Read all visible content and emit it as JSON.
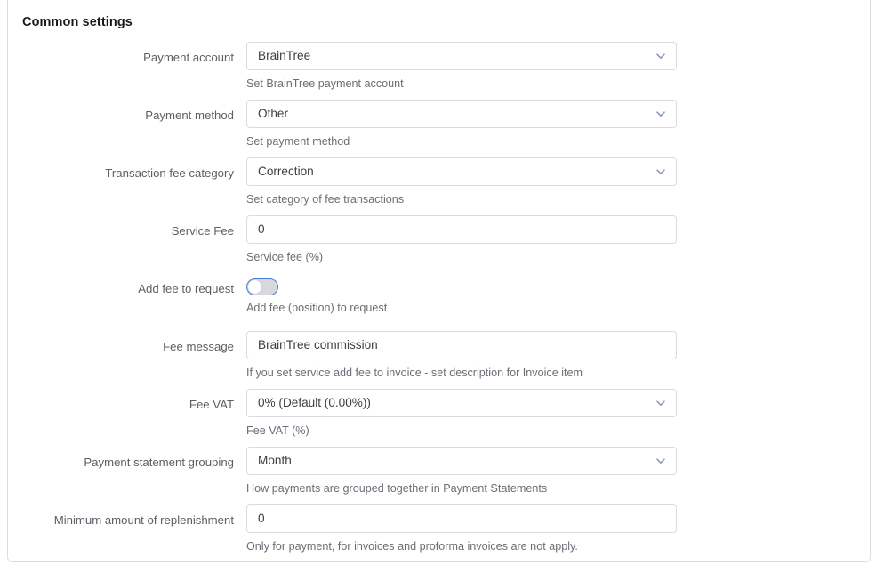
{
  "card": {
    "title": "Common settings"
  },
  "icons": {
    "dropdown": "chevron-down-icon"
  },
  "colors": {
    "accent": "#4a7fe0",
    "card_border": "#dcdcdc",
    "field_border": "#d9dbe0",
    "label_text": "#5b5f66",
    "value_text": "#3c4043",
    "help_text": "#6a6e75",
    "title_text": "#18191b",
    "toggle_track_off": "#d6d8dd"
  },
  "fields": [
    {
      "name": "payment-account",
      "label": "Payment account",
      "type": "select",
      "value": "BrainTree",
      "help": "Set BrainTree payment account"
    },
    {
      "name": "payment-method",
      "label": "Payment method",
      "type": "select",
      "value": "Other",
      "help": "Set payment method"
    },
    {
      "name": "transaction-fee-category",
      "label": "Transaction fee category",
      "type": "select",
      "value": "Correction",
      "help": "Set category of fee transactions"
    },
    {
      "name": "service-fee",
      "label": "Service Fee",
      "type": "text",
      "value": "0",
      "help": "Service fee (%)"
    },
    {
      "name": "add-fee-to-request",
      "label": "Add fee to request",
      "type": "toggle",
      "value": "off",
      "help": "Add fee (position) to request"
    },
    {
      "name": "fee-message",
      "label": "Fee message",
      "type": "text",
      "value": "BrainTree commission",
      "help": "If you set service add fee to invoice - set description for Invoice item"
    },
    {
      "name": "fee-vat",
      "label": "Fee VAT",
      "type": "select",
      "value": "0% (Default (0.00%))",
      "help": "Fee VAT (%)"
    },
    {
      "name": "payment-statement-grouping",
      "label": "Payment statement grouping",
      "type": "select",
      "value": "Month",
      "help": "How payments are grouped together in Payment Statements"
    },
    {
      "name": "minimum-amount-of-replenishment",
      "label": "Minimum amount of replenishment",
      "type": "text",
      "value": "0",
      "help": "Only for payment, for invoices and proforma invoices are not apply."
    }
  ]
}
